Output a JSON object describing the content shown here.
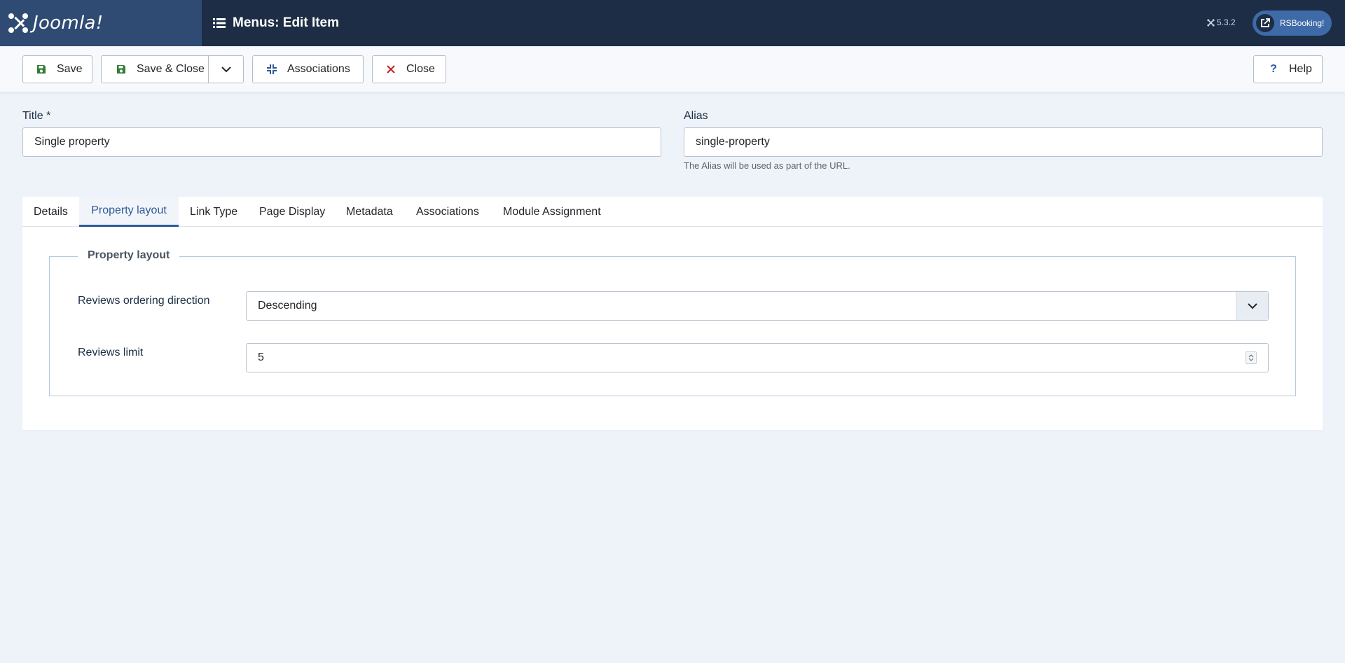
{
  "header": {
    "logo_text": "Joomla!",
    "page_title": "Menus: Edit Item",
    "version": "5.3.2",
    "site_link_label": "RSBooking!"
  },
  "toolbar": {
    "save_label": "Save",
    "save_close_label": "Save & Close",
    "associations_label": "Associations",
    "close_label": "Close",
    "help_label": "Help"
  },
  "form": {
    "title_label": "Title *",
    "title_value": "Single property",
    "alias_label": "Alias",
    "alias_value": "single-property",
    "alias_hint": "The Alias will be used as part of the URL."
  },
  "tabs": [
    {
      "label": "Details",
      "active": false
    },
    {
      "label": "Property layout",
      "active": true
    },
    {
      "label": "Link Type",
      "active": false
    },
    {
      "label": "Page Display",
      "active": false
    },
    {
      "label": "Metadata",
      "active": false
    },
    {
      "label": "Associations",
      "active": false
    },
    {
      "label": "Module Assignment",
      "active": false
    }
  ],
  "property_layout": {
    "legend": "Property layout",
    "ordering_label": "Reviews ordering direction",
    "ordering_value": "Descending",
    "limit_label": "Reviews limit",
    "limit_value": "5"
  },
  "colors": {
    "header_bg": "#1c2d45",
    "logo_bg": "#2f4b73",
    "accent": "#2f5a98",
    "save_icon": "#2f7d32",
    "close_icon": "#c52827"
  }
}
